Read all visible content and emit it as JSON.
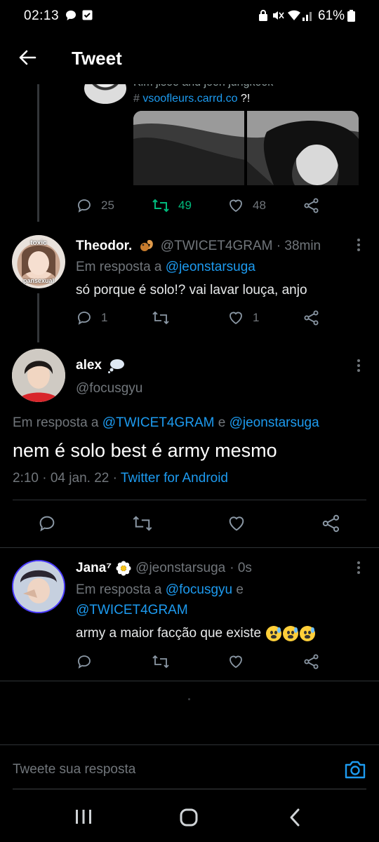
{
  "status_bar": {
    "time": "02:13",
    "battery": "61%"
  },
  "header": {
    "title": "Tweet"
  },
  "parent_tweet": {
    "text_line1": "Kim jisoo and jeon jungkook",
    "link_prefix": "#",
    "link_text": "vsoofleurs.carrd.co",
    "link_suffix": "?!",
    "replies": "25",
    "retweets": "49",
    "likes": "48"
  },
  "reply1": {
    "name": "Theodor.",
    "handle": "@TWICET4GRAM",
    "time": "· 38min",
    "replying_prefix": "Em resposta a",
    "replying_to": "@jeonstarsuga",
    "text": "só porque é solo!? vai lavar louça, anjo",
    "replies": "1",
    "likes": "1",
    "avatar_top": "toxic",
    "avatar_bottom": "pansexual"
  },
  "main_tweet": {
    "name": "alex",
    "handle": "@focusgyu",
    "replying_prefix": "Em resposta a",
    "replying_to_1": "@TWICET4GRAM",
    "replying_join": "e",
    "replying_to_2": "@jeonstarsuga",
    "text": "nem é solo best é army mesmo",
    "date": "2:10 · 04 jan. 22 ·",
    "client": "Twitter for Android"
  },
  "reply2": {
    "name": "Jana⁷",
    "handle": "@jeonstarsuga",
    "time": "· 0s",
    "replying_prefix": "Em resposta a",
    "replying_to_1": "@focusgyu",
    "replying_join": "e",
    "replying_to_2": "@TWICET4GRAM",
    "text": "army a maior facção que existe"
  },
  "composer": {
    "placeholder": "Tweete sua resposta"
  },
  "colors": {
    "accent": "#1d9bf0",
    "retweet_green": "#00ba7c",
    "muted": "#71767b"
  }
}
